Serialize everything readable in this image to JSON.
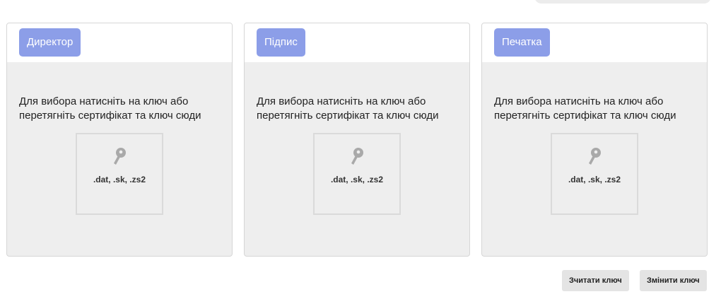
{
  "panels": [
    {
      "tag": "Директор",
      "hint": "Для вибора натисніть на ключ або перетягніть сертифікат та ключ сюди",
      "extensions": ".dat, .sk, .zs2",
      "icon": "key-icon"
    },
    {
      "tag": "Підпис",
      "hint": "Для вибора натисніть на ключ або перетягніть сертифікат та ключ сюди",
      "extensions": ".dat, .sk, .zs2",
      "icon": "key-icon"
    },
    {
      "tag": "Печатка",
      "hint": "Для вибора натисніть на ключ або перетягніть сертифікат та ключ сюди",
      "extensions": ".dat, .sk, .zs2",
      "icon": "key-icon"
    }
  ],
  "actions": {
    "read_key": "Зчитати ключ",
    "change_key": "Змінити ключ"
  },
  "colors": {
    "tag_bg": "#8c9ee8",
    "panel_bg": "#eeeeee",
    "button_bg": "#e4e4e4"
  }
}
